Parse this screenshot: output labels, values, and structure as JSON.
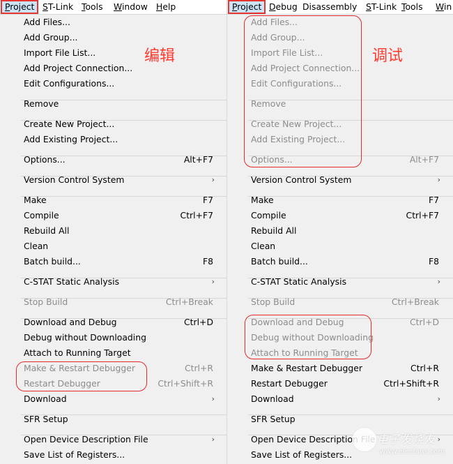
{
  "colors": {
    "annotation_red": "#e5282a",
    "menu_bg": "#f0f0f0",
    "disabled_text": "#8c8c8c",
    "menubar_active_bg": "#cce4f7"
  },
  "left": {
    "annotation": "编辑",
    "menubar": [
      {
        "label": "Project",
        "mnemonic_index": 0,
        "active": true
      },
      {
        "label": "ST-Link",
        "mnemonic_index": 0
      },
      {
        "label": "Tools",
        "mnemonic_index": 0
      },
      {
        "label": "Window",
        "mnemonic_index": 0
      },
      {
        "label": "Help",
        "mnemonic_index": 0
      }
    ],
    "items": [
      {
        "label": "Add Files...",
        "shortcut": "",
        "disabled": false
      },
      {
        "label": "Add Group...",
        "shortcut": "",
        "disabled": false
      },
      {
        "label": "Import File List...",
        "shortcut": "",
        "disabled": false
      },
      {
        "label": "Add Project Connection...",
        "shortcut": "",
        "disabled": false
      },
      {
        "label": "Edit Configurations...",
        "shortcut": "",
        "disabled": false
      },
      {
        "label": "Remove",
        "shortcut": "",
        "disabled": false
      },
      {
        "label": "Create New Project...",
        "shortcut": "",
        "disabled": false
      },
      {
        "label": "Add Existing Project...",
        "shortcut": "",
        "disabled": false
      },
      {
        "label": "Options...",
        "shortcut": "Alt+F7",
        "disabled": false
      },
      {
        "label": "Version Control System",
        "shortcut": "",
        "submenu": true,
        "disabled": false
      },
      {
        "label": "Make",
        "shortcut": "F7",
        "disabled": false
      },
      {
        "label": "Compile",
        "shortcut": "Ctrl+F7",
        "disabled": false
      },
      {
        "label": "Rebuild All",
        "shortcut": "",
        "disabled": false
      },
      {
        "label": "Clean",
        "shortcut": "",
        "disabled": false
      },
      {
        "label": "Batch build...",
        "shortcut": "F8",
        "disabled": false
      },
      {
        "label": "C-STAT Static Analysis",
        "shortcut": "",
        "submenu": true,
        "disabled": false
      },
      {
        "label": "Stop Build",
        "shortcut": "Ctrl+Break",
        "disabled": true
      },
      {
        "label": "Download and Debug",
        "shortcut": "Ctrl+D",
        "disabled": false
      },
      {
        "label": "Debug without Downloading",
        "shortcut": "",
        "disabled": false
      },
      {
        "label": "Attach to Running Target",
        "shortcut": "",
        "disabled": false
      },
      {
        "label": "Make & Restart Debugger",
        "shortcut": "Ctrl+R",
        "disabled": true
      },
      {
        "label": "Restart Debugger",
        "shortcut": "Ctrl+Shift+R",
        "disabled": true
      },
      {
        "label": "Download",
        "shortcut": "",
        "submenu": true,
        "disabled": false
      },
      {
        "label": "SFR Setup",
        "shortcut": "",
        "disabled": false
      },
      {
        "label": "Open Device Description File",
        "shortcut": "",
        "submenu": true,
        "disabled": false
      },
      {
        "label": "Save List of Registers...",
        "shortcut": "",
        "disabled": false
      }
    ]
  },
  "right": {
    "annotation": "调试",
    "menubar": [
      {
        "label": "Project",
        "mnemonic_index": 0,
        "active": true
      },
      {
        "label": "Debug",
        "mnemonic_index": 0
      },
      {
        "label": "Disassembly",
        "mnemonic_index": -1
      },
      {
        "label": "ST-Link",
        "mnemonic_index": 0
      },
      {
        "label": "Tools",
        "mnemonic_index": 0
      },
      {
        "label": "Win",
        "mnemonic_index": 0
      }
    ],
    "items": [
      {
        "label": "Add Files...",
        "shortcut": "",
        "disabled": true
      },
      {
        "label": "Add Group...",
        "shortcut": "",
        "disabled": true
      },
      {
        "label": "Import File List...",
        "shortcut": "",
        "disabled": true
      },
      {
        "label": "Add Project Connection...",
        "shortcut": "",
        "disabled": true
      },
      {
        "label": "Edit Configurations...",
        "shortcut": "",
        "disabled": true
      },
      {
        "label": "Remove",
        "shortcut": "",
        "disabled": true
      },
      {
        "label": "Create New Project...",
        "shortcut": "",
        "disabled": true
      },
      {
        "label": "Add Existing Project...",
        "shortcut": "",
        "disabled": true
      },
      {
        "label": "Options...",
        "shortcut": "Alt+F7",
        "disabled": true
      },
      {
        "label": "Version Control System",
        "shortcut": "",
        "submenu": true,
        "disabled": false
      },
      {
        "label": "Make",
        "shortcut": "F7",
        "disabled": false
      },
      {
        "label": "Compile",
        "shortcut": "Ctrl+F7",
        "disabled": false
      },
      {
        "label": "Rebuild All",
        "shortcut": "",
        "disabled": false
      },
      {
        "label": "Clean",
        "shortcut": "",
        "disabled": false
      },
      {
        "label": "Batch build...",
        "shortcut": "F8",
        "disabled": false
      },
      {
        "label": "C-STAT Static Analysis",
        "shortcut": "",
        "submenu": true,
        "disabled": false
      },
      {
        "label": "Stop Build",
        "shortcut": "Ctrl+Break",
        "disabled": true
      },
      {
        "label": "Download and Debug",
        "shortcut": "Ctrl+D",
        "disabled": true
      },
      {
        "label": "Debug without Downloading",
        "shortcut": "",
        "disabled": true
      },
      {
        "label": "Attach to Running Target",
        "shortcut": "",
        "disabled": true
      },
      {
        "label": "Make & Restart Debugger",
        "shortcut": "Ctrl+R",
        "disabled": false
      },
      {
        "label": "Restart Debugger",
        "shortcut": "Ctrl+Shift+R",
        "disabled": false
      },
      {
        "label": "Download",
        "shortcut": "",
        "submenu": true,
        "disabled": false
      },
      {
        "label": "SFR Setup",
        "shortcut": "",
        "disabled": false
      },
      {
        "label": "Open Device Description File",
        "shortcut": "",
        "submenu": true,
        "disabled": false
      },
      {
        "label": "Save List of Registers...",
        "shortcut": "",
        "disabled": false
      }
    ]
  },
  "watermark": {
    "text": "电子发烧友",
    "url": "www.elecfans.com"
  },
  "submenu_arrow": "›"
}
